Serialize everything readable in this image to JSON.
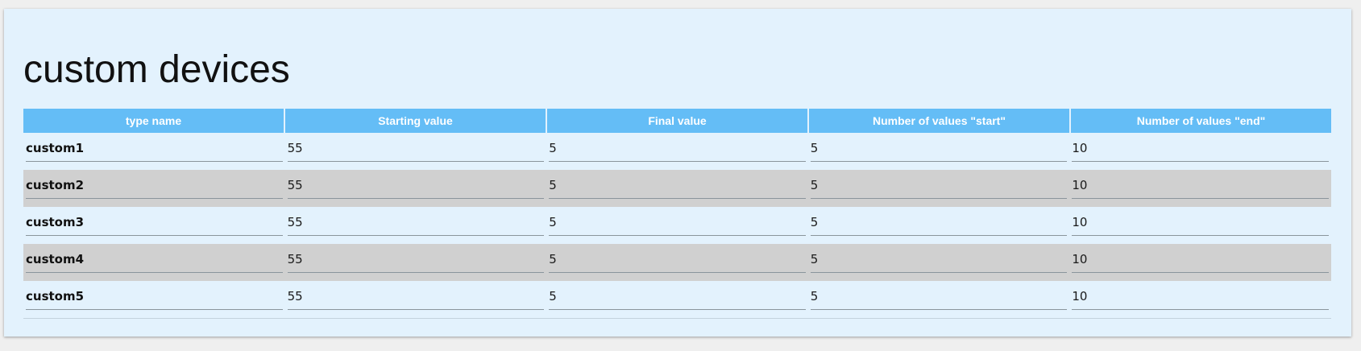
{
  "page": {
    "title": "custom devices"
  },
  "table": {
    "columns": [
      "type name",
      "Starting value",
      "Final value",
      "Number of values \"start\"",
      "Number of values \"end\""
    ],
    "rows": [
      {
        "name": "custom1",
        "start": "55",
        "final": "5",
        "count_start": "5",
        "count_end": "10"
      },
      {
        "name": "custom2",
        "start": "55",
        "final": "5",
        "count_start": "5",
        "count_end": "10"
      },
      {
        "name": "custom3",
        "start": "55",
        "final": "5",
        "count_start": "5",
        "count_end": "10"
      },
      {
        "name": "custom4",
        "start": "55",
        "final": "5",
        "count_start": "5",
        "count_end": "10"
      },
      {
        "name": "custom5",
        "start": "55",
        "final": "5",
        "count_start": "5",
        "count_end": "10"
      }
    ]
  },
  "colors": {
    "panel_background": "#e3f2fd",
    "header_background": "#64bdf6",
    "header_text": "#ffffff",
    "alt_row_background": "#d0d0d0"
  }
}
